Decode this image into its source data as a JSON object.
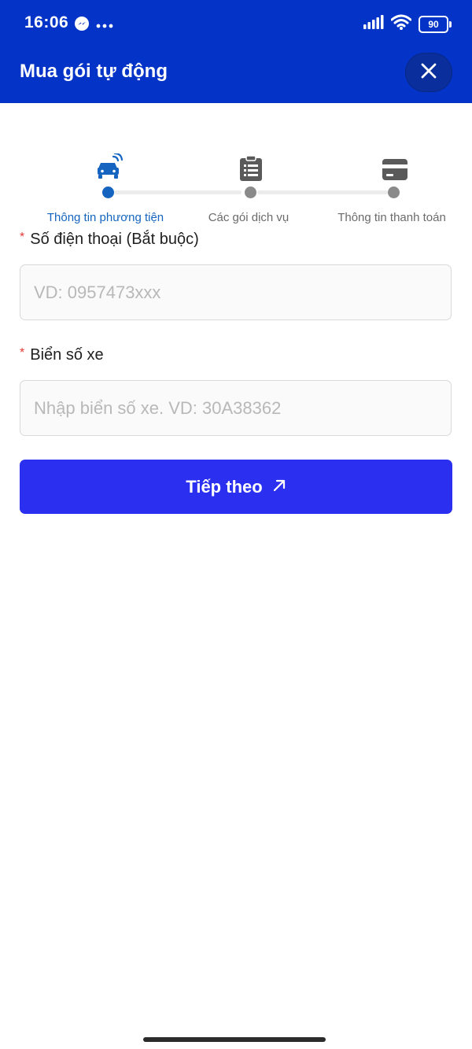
{
  "status_bar": {
    "time": "16:06",
    "battery": "90",
    "icons": [
      "messenger-icon",
      "more-dots-icon",
      "signal-icon",
      "wifi-icon",
      "battery-icon"
    ]
  },
  "header": {
    "title": "Mua gói tự động",
    "close_icon": "close-icon",
    "background": "#0433c8"
  },
  "stepper": {
    "steps": [
      {
        "label": "Thông tin phương tiện",
        "icon": "car-wireless-icon",
        "active": true
      },
      {
        "label": "Các gói dịch vụ",
        "icon": "clipboard-list-icon",
        "active": false
      },
      {
        "label": "Thông tin thanh toán",
        "icon": "credit-card-icon",
        "active": false
      }
    ],
    "active_color": "#1565c0",
    "inactive_color": "#8a8a8a"
  },
  "form": {
    "phone": {
      "required_mark": "*",
      "label": "Số điện thoại (Bắt buộc)",
      "value": "",
      "placeholder": "VD: 0957473xxx"
    },
    "plate": {
      "required_mark": "*",
      "label": "Biển số xe",
      "value": "",
      "placeholder": "Nhập biển số xe. VD: 30A38362"
    },
    "submit": {
      "label": "Tiếp theo",
      "icon": "arrow-up-right-icon",
      "color": "#2a2ff0"
    }
  }
}
